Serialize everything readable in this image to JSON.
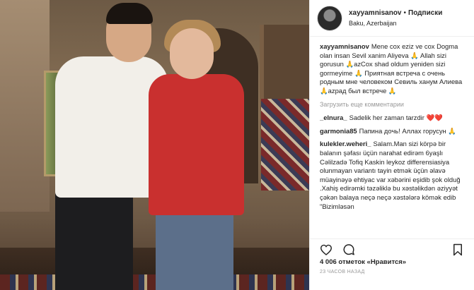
{
  "post": {
    "username": "xayyamnisanov",
    "follow_label": "Подписки",
    "separator": "•",
    "location": "Baku, Azerbaijan",
    "caption": {
      "author": "xayyamnisanov",
      "text": "Mene cox eziz ve cox Dogma olan insan Sevil xanim Aliyeva 🙏 Allah sizi gorusun 🙏azCox shad oldum yeniden sizi gormeyime 🙏 Приятная встреча с очень родным мне человеком Севиль ханум Алиева 🙏azрад был встрече 🙏"
    },
    "load_more_label": "Загрузить еще комментарии",
    "comments": [
      {
        "user": "_elnura_",
        "text": "Sadelik her zaman tarzdir ❤️❤️"
      },
      {
        "user": "garmonia85",
        "text": "Папина дочь! Аллах горусун 🙏"
      },
      {
        "user": "kulekler.weheri_",
        "text": "Salam.Man sizi körpə bir balanın şəfası üçün narahat edirəm 6yaşlı Cəlilzadə Tofiq Kaskin leykoz differensiasiya olunmayan variantı tayin etmək üçün əlavə müayinəyə ehtiyac var xəbərini eşidib şok olduğ .Xahiş edirəmki təzəliklə bu xəstəlikdən əziyyət çəkən balaya neçə neçə xəstələrə kömək edib \"Bizimləsən"
      }
    ],
    "likes_text": "4 006 отметок «Нравится»",
    "time_text": "23 ЧАСОВ НАЗАД",
    "icons": [
      "heart-icon",
      "comment-icon",
      "bookmark-icon"
    ]
  }
}
